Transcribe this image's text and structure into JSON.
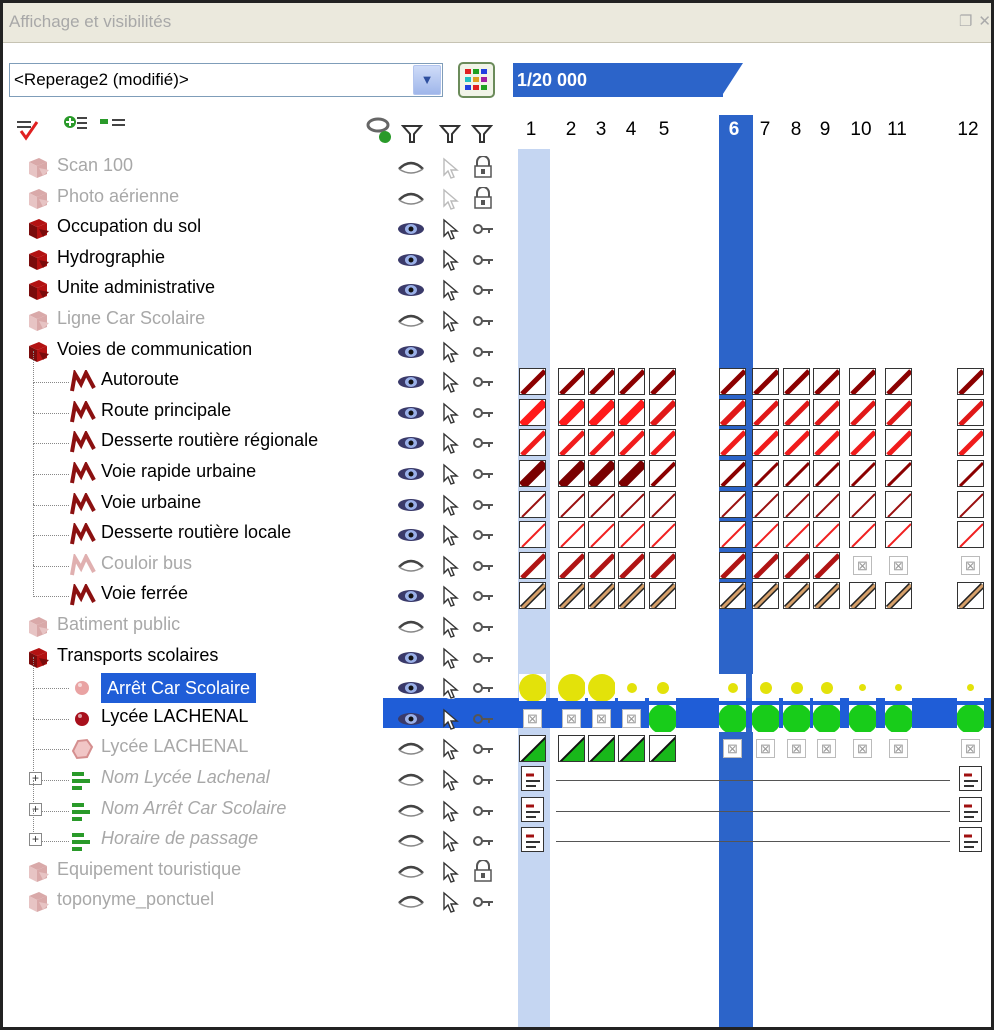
{
  "window": {
    "title": "Affichage et visibilités",
    "selector_value": "<Reperage2 (modifié)>",
    "scale": "1/20 000",
    "active_column": "6",
    "columns": [
      "1",
      "2",
      "3",
      "4",
      "5",
      "6",
      "7",
      "8",
      "9",
      "10",
      "11",
      "12"
    ]
  },
  "layers": [
    {
      "name": "Scan 100",
      "state": "dim",
      "indent": 0,
      "icon": "layer-group-icon",
      "eye": "off",
      "lock": "locked"
    },
    {
      "name": "Photo aérienne",
      "state": "dim",
      "indent": 0,
      "icon": "layer-group-icon",
      "eye": "off",
      "lock": "locked"
    },
    {
      "name": "Occupation du sol",
      "state": "normal",
      "indent": 0,
      "icon": "layer-group-icon",
      "eye": "on",
      "lock": "unlocked"
    },
    {
      "name": "Hydrographie",
      "state": "normal",
      "indent": 0,
      "icon": "layer-group-icon",
      "eye": "on",
      "lock": "unlocked"
    },
    {
      "name": "Unite administrative",
      "state": "normal",
      "indent": 0,
      "icon": "layer-group-icon",
      "eye": "on",
      "lock": "unlocked"
    },
    {
      "name": "Ligne Car Scolaire",
      "state": "dim",
      "indent": 0,
      "icon": "layer-group-icon",
      "eye": "off",
      "lock": "unlocked"
    },
    {
      "name": "Voies de communication",
      "state": "normal",
      "indent": 0,
      "icon": "layer-group-icon",
      "eye": "on",
      "lock": "unlocked"
    },
    {
      "name": "Autoroute",
      "state": "normal",
      "indent": 1,
      "icon": "line-style-icon",
      "eye": "on",
      "lock": "unlocked"
    },
    {
      "name": "Route principale",
      "state": "normal",
      "indent": 1,
      "icon": "line-style-icon",
      "eye": "on",
      "lock": "unlocked"
    },
    {
      "name": "Desserte routière régionale",
      "state": "normal",
      "indent": 1,
      "icon": "line-style-icon",
      "eye": "on",
      "lock": "unlocked"
    },
    {
      "name": "Voie rapide urbaine",
      "state": "normal",
      "indent": 1,
      "icon": "line-style-icon",
      "eye": "on",
      "lock": "unlocked"
    },
    {
      "name": "Voie urbaine",
      "state": "normal",
      "indent": 1,
      "icon": "line-style-icon",
      "eye": "on",
      "lock": "unlocked"
    },
    {
      "name": "Desserte routière locale",
      "state": "normal",
      "indent": 1,
      "icon": "line-style-icon",
      "eye": "on",
      "lock": "unlocked"
    },
    {
      "name": "Couloir bus",
      "state": "dim",
      "indent": 1,
      "icon": "line-style-icon",
      "eye": "off",
      "lock": "unlocked"
    },
    {
      "name": "Voie ferrée",
      "state": "normal",
      "indent": 1,
      "icon": "line-style-icon",
      "eye": "on",
      "lock": "unlocked"
    },
    {
      "name": "Batiment public",
      "state": "dim",
      "indent": 0,
      "icon": "layer-group-icon",
      "eye": "off",
      "lock": "unlocked"
    },
    {
      "name": "Transports scolaires",
      "state": "normal",
      "indent": 0,
      "icon": "layer-group-icon",
      "eye": "on",
      "lock": "unlocked"
    },
    {
      "name": "Arrêt Car Scolaire",
      "state": "selected",
      "indent": 1,
      "icon": "point-style-icon",
      "eye": "on",
      "lock": "unlocked"
    },
    {
      "name": "Lycée LACHENAL",
      "state": "normal",
      "indent": 1,
      "icon": "point-style-icon",
      "eye": "on",
      "lock": "unlocked"
    },
    {
      "name": "Lycée LACHENAL",
      "state": "dim",
      "indent": 1,
      "icon": "polygon-style-icon",
      "eye": "off",
      "lock": "unlocked"
    },
    {
      "name": "Nom Lycée Lachenal",
      "state": "dim-italic",
      "indent": 1,
      "icon": "label-style-icon",
      "eye": "off",
      "lock": "unlocked",
      "expandable": true
    },
    {
      "name": "Nom Arrêt Car Scolaire",
      "state": "dim-italic",
      "indent": 1,
      "icon": "label-style-icon",
      "eye": "off",
      "lock": "unlocked",
      "expandable": true
    },
    {
      "name": "Horaire de passage",
      "state": "dim-italic",
      "indent": 1,
      "icon": "label-style-icon",
      "eye": "off",
      "lock": "unlocked",
      "expandable": true
    },
    {
      "name": "Equipement touristique",
      "state": "dim",
      "indent": 0,
      "icon": "layer-group-icon",
      "eye": "off",
      "lock": "locked"
    },
    {
      "name": "toponyme_ponctuel",
      "state": "dim",
      "indent": 0,
      "icon": "layer-group-icon",
      "eye": "off",
      "lock": "unlocked"
    }
  ],
  "colors": {
    "accent_blue": "#2c64c9",
    "selection_blue": "#1f5dd7",
    "dark_red": "#8b0000",
    "red": "#e0201c",
    "yellow": "#e3e20a",
    "green": "#18cc1a",
    "tan": "#d6a06a"
  }
}
